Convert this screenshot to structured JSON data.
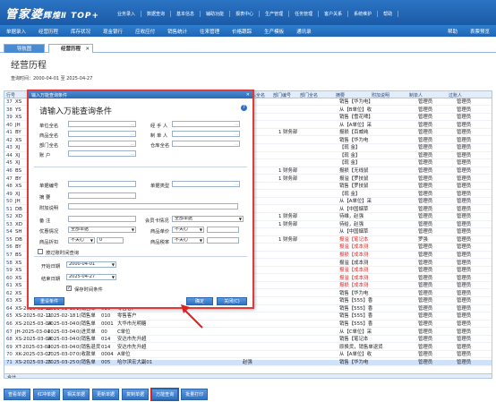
{
  "app": {
    "logo_main": "管家婆",
    "logo_sub": "辉煌Ⅱ TOP+"
  },
  "nav": [
    "业务录入",
    "数据查询",
    "基本信息",
    "辅助功能",
    "报表中心",
    "生产管理",
    "任务管理",
    "客户关系",
    "系统维护",
    "帮助"
  ],
  "toolbar": [
    "单据录入",
    "经营历程",
    "库存状况",
    "现金银行",
    "应收应付",
    "销售统计",
    "往来管理",
    "价格跟踪",
    "生产模板",
    "通讯录",
    "帮助",
    "表票预览"
  ],
  "tabs": {
    "home": "导航图",
    "history": "经营历程"
  },
  "page": {
    "title": "经营历程",
    "query_time": "查询时间：2000-04-01 至 2025-04-27"
  },
  "grid": {
    "headers": [
      "行号",
      "录单日期",
      "单据日期",
      "单据编号",
      "单据类型",
      "客户/供应商",
      "经手人全名",
      "部门编号",
      "部门全名",
      "摘要",
      "附加说明",
      "制单人",
      "过账人"
    ],
    "rows": [
      {
        "no": "37",
        "a": "XS",
        "n": "",
        "m": "",
        "s": "销售【华为电】",
        "u": "管理员",
        "v": "管理员"
      },
      {
        "no": "38",
        "a": "YS",
        "n": "",
        "m": "",
        "s": "从【B单位】收",
        "u": "管理员",
        "v": "管理员"
      },
      {
        "no": "39",
        "a": "XS",
        "n": "",
        "m": "",
        "s": "销售【雪花啤】",
        "u": "管理员",
        "v": "管理员"
      },
      {
        "no": "40",
        "a": "JH",
        "n": "",
        "m": "",
        "s": "从【A单位】采",
        "u": "管理员",
        "v": "管理员"
      },
      {
        "no": "41",
        "a": "BY",
        "n": "赵强",
        "m": "1 财务部",
        "s": "报损【百威纯",
        "u": "管理员",
        "v": "管理员"
      },
      {
        "no": "42",
        "a": "XS",
        "n": "",
        "m": "",
        "s": "销售【华为电",
        "u": "管理员",
        "v": "管理员"
      },
      {
        "no": "43",
        "a": "XJ",
        "n": "",
        "m": "",
        "s": "【现   金】",
        "u": "管理员",
        "v": "管理员"
      },
      {
        "no": "44",
        "a": "XJ",
        "n": "",
        "m": "",
        "s": "【现   金】",
        "u": "管理员",
        "v": "管理员"
      },
      {
        "no": "45",
        "a": "XJ",
        "n": "",
        "m": "",
        "s": "【现   金】",
        "u": "管理员",
        "v": "管理员"
      },
      {
        "no": "46",
        "a": "BS",
        "n": "赵强",
        "m": "1 财务部",
        "s": "报损【无线鼠",
        "u": "管理员",
        "v": "管理员"
      },
      {
        "no": "47",
        "a": "BY",
        "n": "赵强",
        "m": "1 财务部",
        "s": "报溢【罗技鼠",
        "u": "管理员",
        "v": "管理员"
      },
      {
        "no": "48",
        "a": "XS",
        "n": "",
        "m": "",
        "s": "销售【罗技鼠",
        "u": "管理员",
        "v": "管理员"
      },
      {
        "no": "49",
        "a": "XJ",
        "n": "",
        "m": "",
        "s": "【现   金】",
        "u": "管理员",
        "v": "管理员"
      },
      {
        "no": "50",
        "a": "JH",
        "n": "",
        "m": "",
        "s": "从【A单位】采",
        "u": "管理员",
        "v": "管理员"
      },
      {
        "no": "51",
        "a": "DB",
        "n": "",
        "m": "",
        "s": "从【中国烟草",
        "u": "管理员",
        "v": "管理员"
      },
      {
        "no": "52",
        "a": "XD",
        "n": "赵强",
        "m": "1 财务部",
        "s": "待维，赵强",
        "u": "管理员",
        "v": "管理员"
      },
      {
        "no": "53",
        "a": "XD",
        "n": "赵强",
        "m": "1 财务部",
        "s": "待给，赵强",
        "u": "管理员",
        "v": "管理员"
      },
      {
        "no": "54",
        "a": "SH",
        "n": "",
        "m": "",
        "s": "从【中国烟草",
        "u": "管理员",
        "v": "管理员"
      },
      {
        "no": "55",
        "a": "DB",
        "n": "罗强",
        "m": "1 财务部",
        "s": "报溢【笔记本",
        "u": "罗强",
        "v": "管理员",
        "red": true
      },
      {
        "no": "56",
        "a": "BY",
        "n": "",
        "m": "",
        "s": "报溢【成本测",
        "u": "管理员",
        "v": "管理员",
        "red": true
      },
      {
        "no": "57",
        "a": "BS",
        "n": "",
        "m": "",
        "s": "报损【成本测",
        "u": "管理员",
        "v": "管理员",
        "red": true
      },
      {
        "no": "58",
        "a": "XS",
        "n": "",
        "m": "",
        "s": "报溢【成本测",
        "u": "管理员",
        "v": "管理员"
      },
      {
        "no": "59",
        "a": "XS",
        "n": "",
        "m": "",
        "s": "报溢【成本测",
        "u": "管理员",
        "v": "管理员",
        "red": true
      },
      {
        "no": "60",
        "a": "XS",
        "n": "",
        "m": "",
        "s": "报溢【成本测",
        "u": "管理员",
        "v": "管理员",
        "red": true
      },
      {
        "no": "61",
        "a": "XS",
        "n": "",
        "m": "",
        "s": "报损【成本测",
        "u": "管理员",
        "v": "管理员",
        "red": true
      },
      {
        "no": "62",
        "a": "XS",
        "n": "",
        "m": "",
        "s": "销售【华为电",
        "u": "管理员",
        "v": "管理员"
      },
      {
        "no": "63",
        "a": "XS",
        "n": "",
        "m": "",
        "s": "销售【555】香",
        "u": "管理员",
        "v": "管理员"
      },
      {
        "no": "64",
        "a": "XS-2025-02-11",
        "b": "2025-02-18",
        "c": "1(销售单",
        "d": "010",
        "e": "零售客户",
        "n": "",
        "m": "",
        "s": "销售【555】香",
        "u": "管理员",
        "v": "管理员"
      },
      {
        "no": "65",
        "a": "XS-2025-02-11",
        "b": "2025-02-18",
        "c": "1(销售单",
        "d": "010",
        "e": "零售客户",
        "n": "",
        "m": "",
        "s": "销售【555】香",
        "u": "管理员",
        "v": "管理员"
      },
      {
        "no": "66",
        "a": "XS-2025-03-04",
        "b": "2025-03-04",
        "c": "0(销售单",
        "d": "0001",
        "e": "大华市光明糖",
        "n": "",
        "m": "",
        "s": "销售【555】香",
        "u": "管理员",
        "v": "管理员"
      },
      {
        "no": "67",
        "a": "JH-2025-03-04",
        "b": "2025-03-04",
        "c": "0(进货单",
        "d": "00",
        "e": "C单位",
        "n": "",
        "m": "",
        "s": "从【C单位】采",
        "u": "管理员",
        "v": "管理员"
      },
      {
        "no": "68",
        "a": "XS-2025-03-04",
        "b": "2025-03-04",
        "c": "0(销售单",
        "d": "014",
        "e": "安达市先升超",
        "n": "",
        "m": "",
        "s": "销售【笔记本",
        "u": "管理员",
        "v": "管理员"
      },
      {
        "no": "69",
        "a": "XT-2025-03-04",
        "b": "2025-03-04",
        "c": "0(销售退货",
        "d": "014",
        "e": "安达市先升超",
        "n": "",
        "m": "",
        "s": "原换货，销售单退货",
        "u": "管理员",
        "v": "管理员"
      },
      {
        "no": "70",
        "a": "XK-2025-03-07",
        "b": "2025-03-07",
        "c": "0(收款单",
        "d": "0004",
        "e": "A单位",
        "n": "",
        "m": "",
        "s": "从【A单位】收",
        "u": "管理员",
        "v": "管理员"
      },
      {
        "no": "71",
        "a": "XS-2025-03-25",
        "b": "2025-03-25",
        "c": "0(销售单",
        "d": "005",
        "e": "哈尔滨宏大副01",
        "n": "赵强",
        "m": "",
        "s": "销售【华为电",
        "u": "管理员",
        "v": "管理员",
        "sel": true
      }
    ],
    "footer": "合计"
  },
  "bottom_buttons": [
    "查看单据",
    "红冲单据",
    "相关单据",
    "更新单据",
    "复制单据",
    "万能查询",
    "批量打印"
  ],
  "dialog": {
    "title": "输入万能查询条件",
    "heading": "请输入万能查询条件",
    "labels": {
      "unit": "单位全名",
      "handler": "经 手 人",
      "product": "商品全名",
      "maker": "制 单 人",
      "dept": "部门全名",
      "warehouse": "仓库全名",
      "account": "账    户",
      "billno": "单据编号",
      "billtype": "单据类型",
      "summary": "摘    要",
      "addnote": "附加说明",
      "remark": "备    注",
      "membercard": "会员卡情况",
      "discount": "优惠情况",
      "price": "商品单价",
      "priceunit": "商品折扣",
      "tax": "商品税率",
      "bydate": "按过账时间查询",
      "startdate": "开始日期",
      "enddate": "结束日期",
      "savetime": "保存时间条件"
    },
    "values": {
      "membercard": "全部单据",
      "discount": "全部单据",
      "price_op": "不关心",
      "priceunit_op": "不关心",
      "tax_op": "不关心",
      "tax_op2": "不关心",
      "num0": "0",
      "start": "2000-04-01",
      "end": "2025-04-27"
    },
    "buttons": {
      "reset": "重设条件",
      "ok": "确定",
      "cancel": "关闭(C)"
    }
  }
}
